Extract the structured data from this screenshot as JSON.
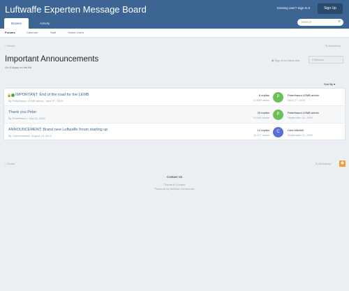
{
  "header": {
    "brand": "Luftwaffe Experten Message Board",
    "existing_user": "Existing user? Sign In ▾",
    "signup": "Sign Up",
    "tabs": [
      {
        "label": "Browse"
      },
      {
        "label": "Activity"
      }
    ],
    "search_placeholder": "Search"
  },
  "subnav": [
    "Forums",
    "Calendar",
    "Staff",
    "Online Users"
  ],
  "breadcrumb": {
    "home": "Home",
    "all_activity": "All Activity"
  },
  "page": {
    "title": "Important Announcements",
    "subtitle": "Go & Apply on the list",
    "follow_link": "Sign in to follow this",
    "followers_button": "Followers",
    "sort": "Sort By ▾"
  },
  "colors": {
    "header": "#3d6594",
    "link": "#3d6594",
    "avatar_green": "#6bbf59",
    "avatar_blue": "#5a6fd6",
    "rss": "#f09a3a"
  },
  "topics": [
    {
      "title": "IMPORTANT: End of the road for the LEMB",
      "meta": "By Peterthauro LEMB admin, June 27, 2019",
      "replies": "6 replies",
      "views": "10,689 views",
      "avatar_letter": "P",
      "avatar_color": "#6bbf59",
      "last_user": "Peterthauro LEMB admin",
      "last_date": "June 27, 2019",
      "locked": true,
      "pinned": true
    },
    {
      "title": "Thank you Peter",
      "meta": "By Peterthauro, July 04, 2019",
      "replies": "33 replies",
      "views": "19,440 views",
      "avatar_letter": "P",
      "avatar_color": "#6bbf59",
      "last_user": "Peterthauro LEMB admin",
      "last_date": "September 22, 2019",
      "locked": false,
      "pinned": false
    },
    {
      "title": "ANNOUNCEMENT: Brand new Luftwaffe forum starting up",
      "meta": "By Cybermenace, August 14, 2019",
      "replies": "14 replies",
      "views": "12,117 views",
      "avatar_letter": "C",
      "avatar_color": "#5a6fd6",
      "last_user": "Cent Mitchell",
      "last_date": "September 21, 2019",
      "locked": false,
      "pinned": false
    }
  ],
  "footer": {
    "contact": "Contact Us",
    "theme": "Theme ▸ Contact",
    "powered": "Powered by Invision Community"
  }
}
